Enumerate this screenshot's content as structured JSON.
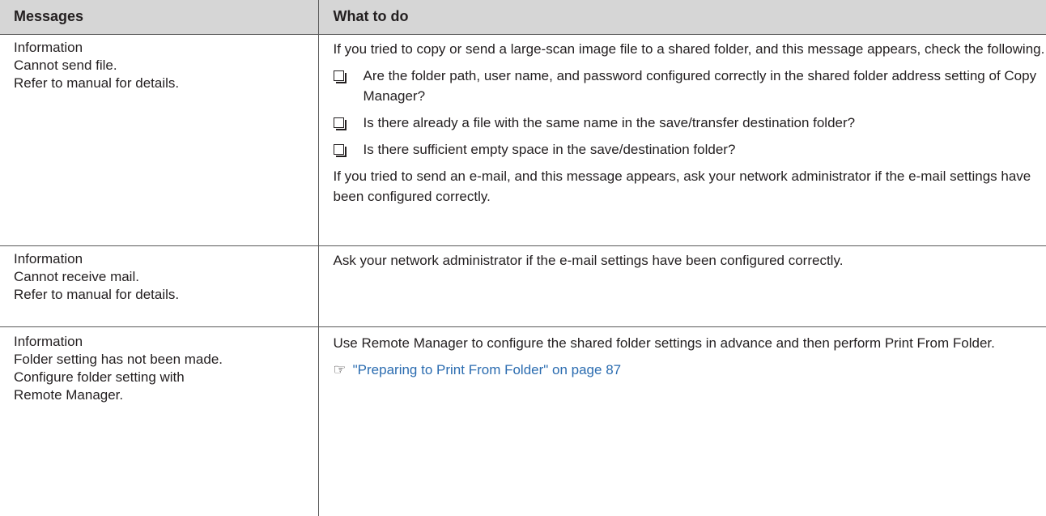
{
  "headers": [
    "Messages",
    "What to do"
  ],
  "rows": [
    {
      "message": [
        "Information",
        "Cannot send file.",
        "Refer to manual for details."
      ],
      "intro": "If you tried to copy or send a large-scan image file to a shared folder, and this message appears, check the following.",
      "bullets": [
        "Are the folder path, user name, and password configured correctly in the shared folder address setting of Copy Manager?",
        "Is there already a file with the same name in the save/transfer destination folder?",
        "Is there sufficient empty space in the save/destination folder?"
      ],
      "outro": "If you tried to send an e-mail, and this message appears, ask your network administrator if the e-mail settings have been configured correctly."
    },
    {
      "message": [
        "Information",
        "Cannot receive mail.",
        "Refer to manual for details."
      ],
      "intro": "Ask your network administrator if the e-mail settings have been configured correctly."
    },
    {
      "message": [
        "Information",
        "Folder setting has not been made.",
        "Configure folder setting with",
        "Remote Manager."
      ],
      "intro": "Use Remote Manager to configure the shared folder settings in advance and then perform Print From Folder.",
      "ref_icon": "pointing-hand-icon",
      "ref_link": "\"Preparing to Print From Folder\" on page 87"
    }
  ]
}
